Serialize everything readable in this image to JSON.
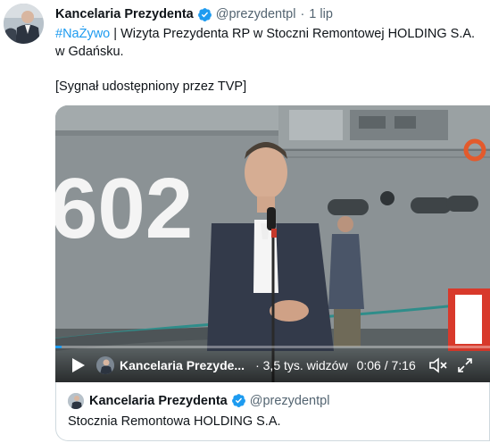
{
  "tweet": {
    "author_name": "Kancelaria Prezydenta",
    "handle": "@prezydentpl",
    "separator": "·",
    "date": "1 lip",
    "hashtag": "#NaŻywo",
    "text_main": " | Wizyta Prezydenta RP w Stoczni Remontowej HOLDING S.A. w Gdańsku.",
    "text_note": "[Sygnał udostępniony przez TVP]"
  },
  "video": {
    "hull_number": "602",
    "author": "Kancelaria Prezyde...",
    "separator": "·",
    "views": "3,5 tys. widzów",
    "current_time": "0:06",
    "duration": "7:16",
    "time_display": "0:06 / 7:16",
    "progress_fraction": 0.014
  },
  "quoted": {
    "author_name": "Kancelaria Prezydenta",
    "handle": "@prezydentpl",
    "text": "Stocznia Remontowa HOLDING S.A."
  },
  "colors": {
    "accent": "#1d9bf0",
    "muted": "#536471",
    "text": "#0f1419",
    "border": "#cfd9de"
  }
}
